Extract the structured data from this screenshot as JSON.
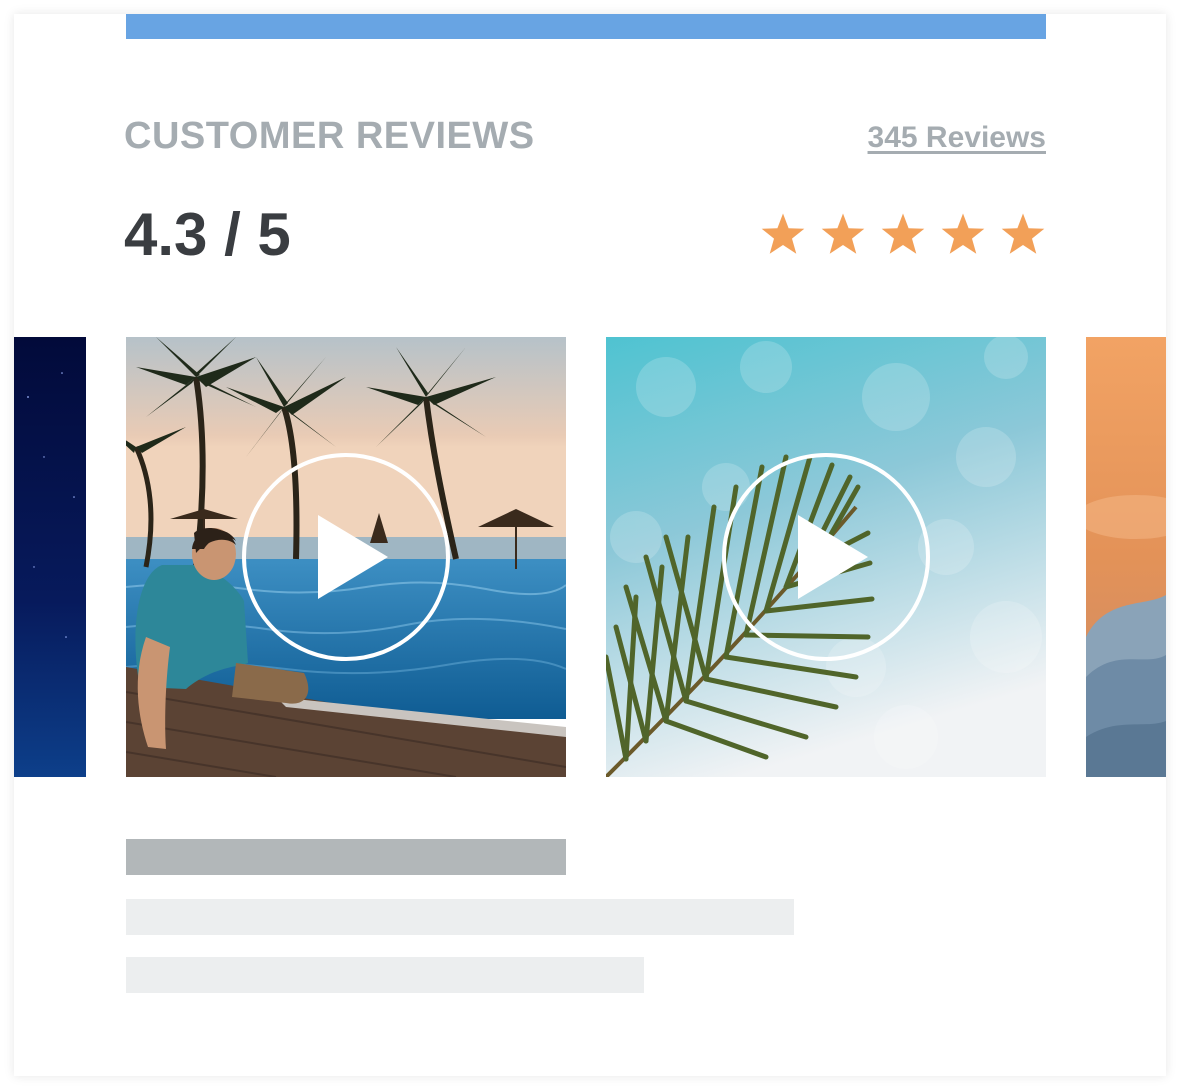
{
  "colors": {
    "accent_bar": "#68a4e3",
    "title_gray": "#a5acb1",
    "score_dark": "#3a3d41",
    "star_orange": "#f2a058",
    "placeholder_dark": "#b2b7b9",
    "placeholder_light": "#eceeef"
  },
  "reviews": {
    "title": "CUSTOMER REVIEWS",
    "count_link": "345 Reviews",
    "score": "4.3 / 5",
    "stars_shown": 5
  },
  "gallery": {
    "items": [
      {
        "scene": "night-sky",
        "partial": true,
        "icon": null
      },
      {
        "scene": "resort-pool-sunset",
        "partial": false,
        "icon": "play-icon"
      },
      {
        "scene": "palm-leaf-bokeh",
        "partial": false,
        "icon": "play-icon"
      },
      {
        "scene": "sunset-clouds",
        "partial": true,
        "icon": null
      }
    ]
  }
}
